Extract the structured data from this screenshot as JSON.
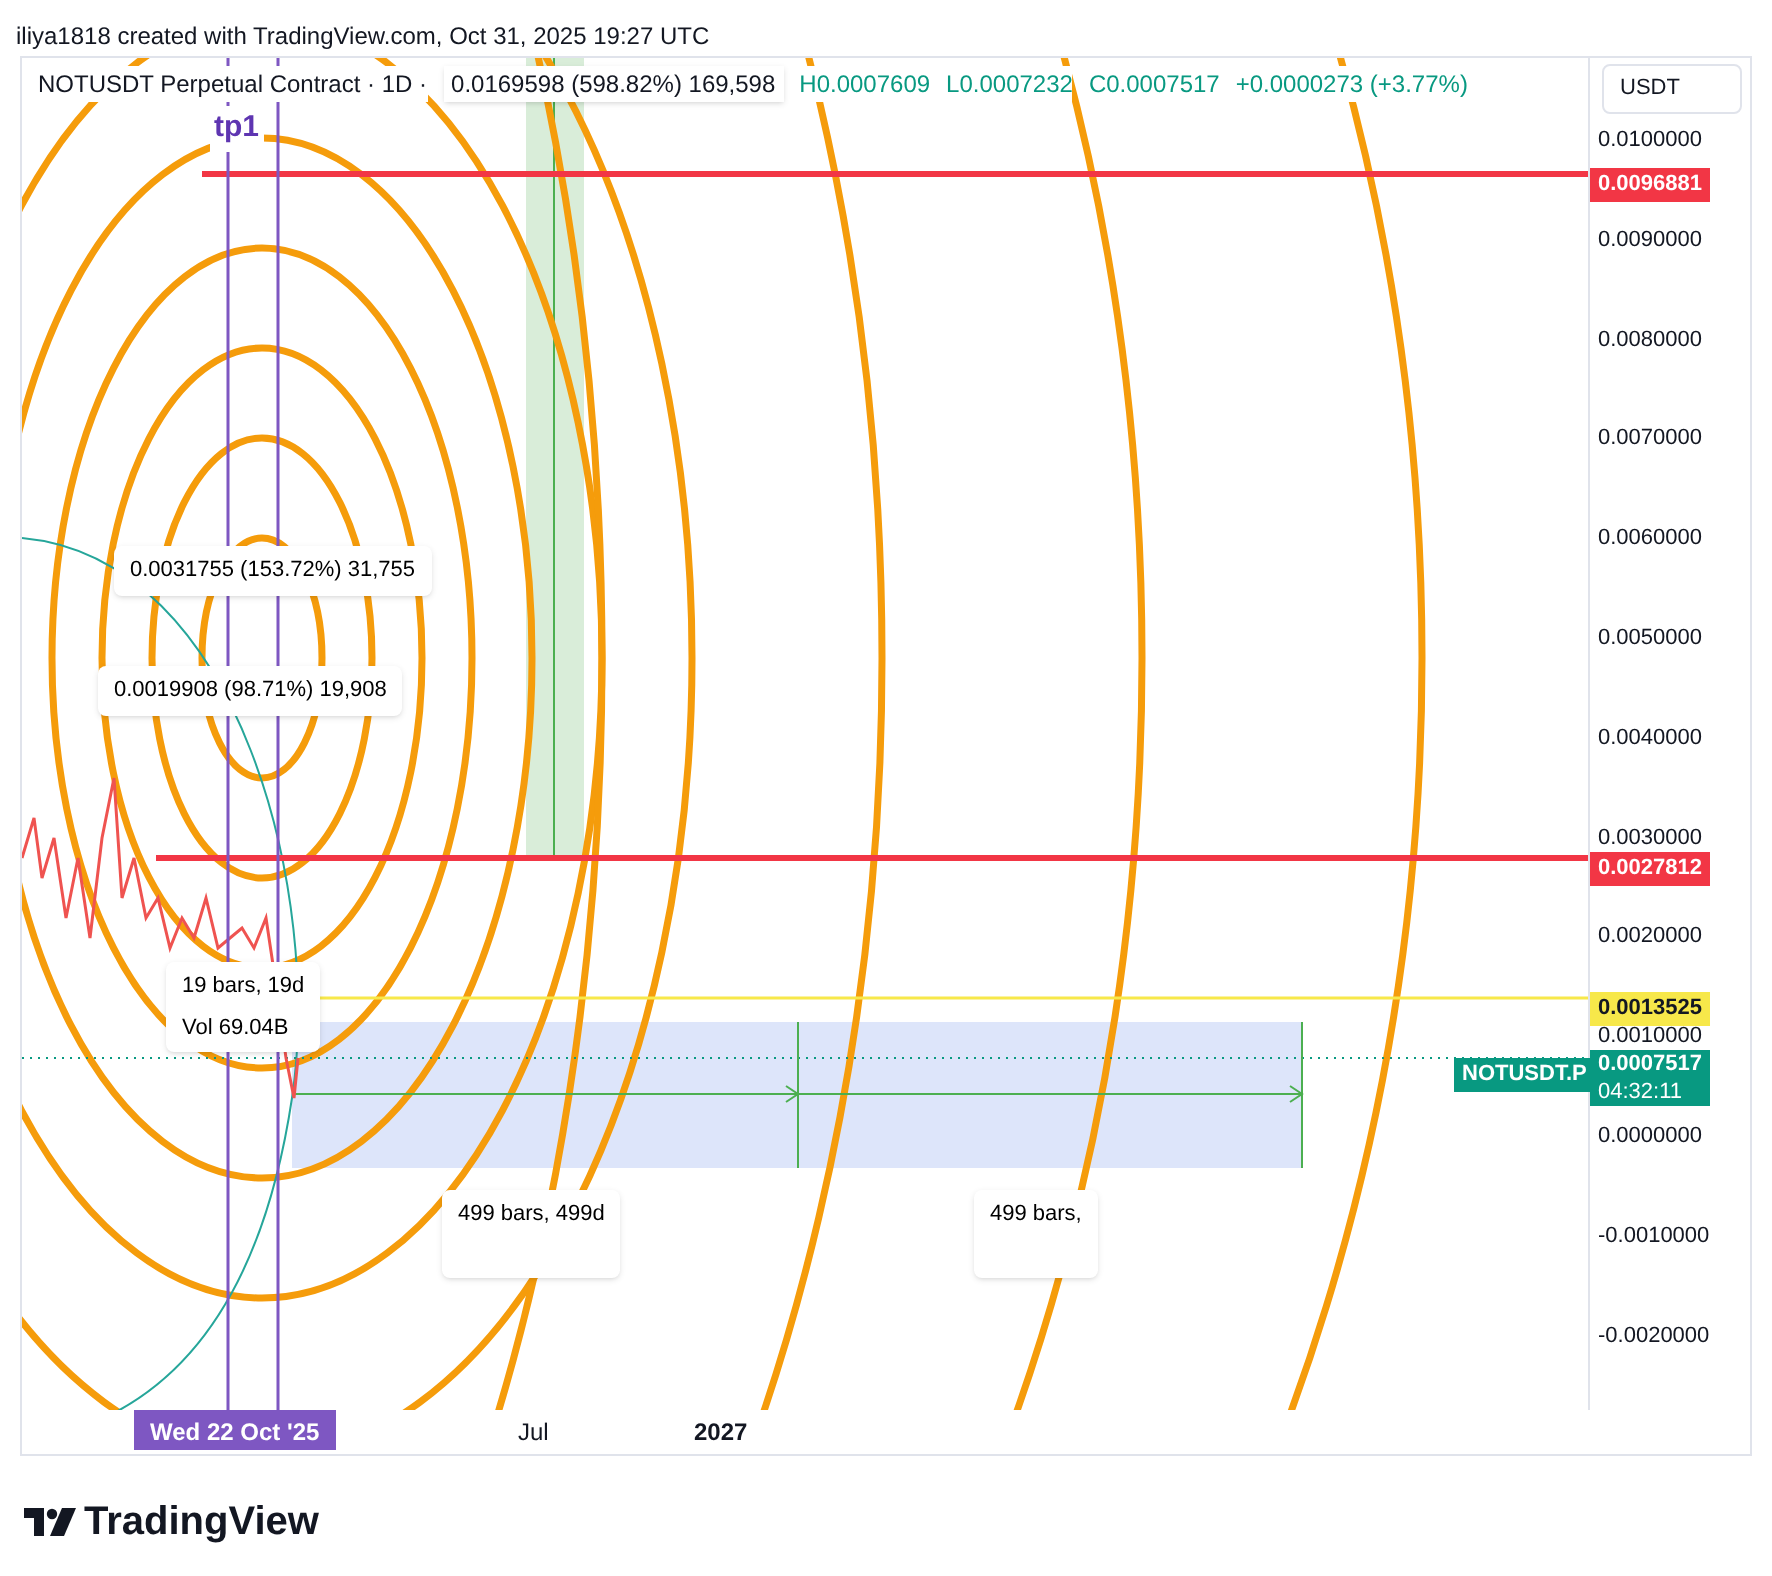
{
  "caption": "iliya1818 created with TradingView.com, Oct 31, 2025 19:27 UTC",
  "legend": {
    "title": "NOTUSDT Perpetual Contract · 1D ·",
    "values": [
      {
        "text": "H0.0007609"
      },
      {
        "text": "L0.0007232"
      },
      {
        "text": "C0.0007517"
      },
      {
        "text": "+0.0000273 (+3.77%)"
      }
    ]
  },
  "currency_button": "USDT",
  "tp_label": "tp1",
  "measure_labels": [
    {
      "text": "0.0169598 (598.82%) 169,598"
    },
    {
      "text": "0.0031755 (153.72%) 31,755"
    },
    {
      "text": "0.0019908 (98.71%) 19,908"
    }
  ],
  "range_tooltip": {
    "bars": "19 bars, 19d",
    "volume": "Vol 69.04B"
  },
  "projection_labels": [
    "499 bars, 499d",
    "499 bars,"
  ],
  "price_ticks": [
    "0.0100000",
    "0.0090000",
    "0.0080000",
    "0.0070000",
    "0.0060000",
    "0.0050000",
    "0.0040000",
    "0.0030000",
    "0.0020000",
    "0.0010000",
    "0.0000000",
    "-0.0010000",
    "-0.0020000"
  ],
  "price_labels": [
    {
      "text": "0.0096881",
      "color": "#f23645"
    },
    {
      "text": "0.0027812",
      "color": "#f23645"
    },
    {
      "text": "0.0013525",
      "color": "#f7e84a"
    }
  ],
  "symbol_label": {
    "symbol": "NOTUSDT.P",
    "price": "0.0007517",
    "countdown": "04:32:11"
  },
  "time_axis": {
    "crosshair_label": "Wed 22 Oct '25",
    "ticks": [
      {
        "text": "Jul",
        "bold": false
      },
      {
        "text": "2027",
        "bold": true
      }
    ]
  },
  "brand": "TradingView"
}
